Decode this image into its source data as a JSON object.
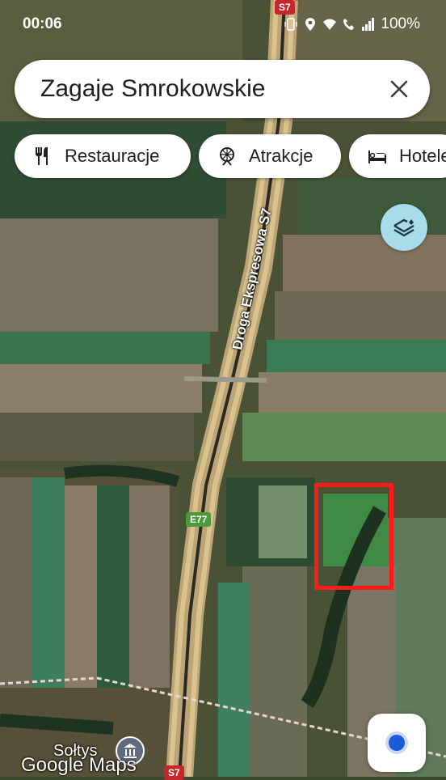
{
  "status_bar": {
    "time": "00:06",
    "battery": "100%",
    "icons": [
      "vibrate-icon",
      "location-icon",
      "wifi-icon",
      "wifi-call-icon",
      "signal-icon"
    ]
  },
  "search": {
    "query": "Zagaje Smrokowskie",
    "clear_icon": "close-icon"
  },
  "chips": [
    {
      "label": "Restauracje",
      "icon": "restaurant-icon"
    },
    {
      "label": "Atrakcje",
      "icon": "attraction-icon"
    },
    {
      "label": "Hotele",
      "icon": "hotel-icon"
    }
  ],
  "layers_button": {
    "icon": "layers-icon"
  },
  "map": {
    "road_name": "Droga Ekspresowa S7",
    "route_shield_top": "S7",
    "route_shield_mid": "E77",
    "route_shield_bottom": "S7",
    "poi_name": "Sołtys",
    "logo": "Google Maps"
  },
  "colors": {
    "highlight": "#ff1a1a",
    "location_dot": "#1a5cd6",
    "layers_bg": "#a8dcea"
  }
}
